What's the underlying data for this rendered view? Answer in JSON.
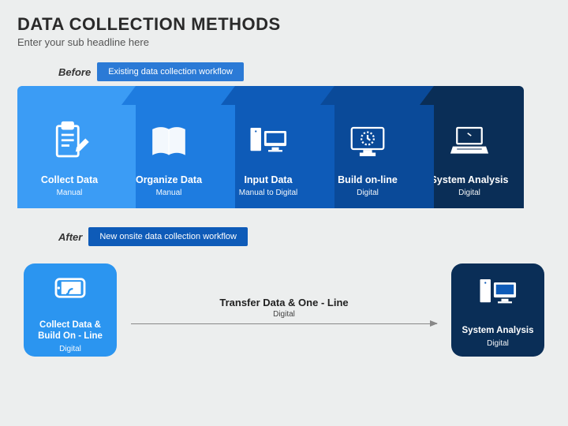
{
  "title": "DATA COLLECTION METHODS",
  "subtitle": "Enter your sub headline here",
  "before": {
    "label": "Before",
    "pill": "Existing data collection workflow",
    "pill_color": "#2b7ad6",
    "cards": [
      {
        "title": "Collect Data",
        "sub": "Manual",
        "color": "#3b9cf5",
        "icon": "clipboard"
      },
      {
        "title": "Organize Data",
        "sub": "Manual",
        "color": "#1e7ce0",
        "icon": "book"
      },
      {
        "title": "Input Data",
        "sub": "Manual to Digital",
        "color": "#0e5bb8",
        "icon": "desktop"
      },
      {
        "title": "Build on-line",
        "sub": "Digital",
        "color": "#0a4a99",
        "icon": "monitor"
      },
      {
        "title": "System Analysis",
        "sub": "Digital",
        "color": "#0a2e57",
        "icon": "laptop"
      }
    ]
  },
  "after": {
    "label": "After",
    "pill": "New onsite data collection workflow",
    "pill_color": "#0e5bb8",
    "left": {
      "title": "Collect Data & Build On - Line",
      "sub": "Digital",
      "color": "#2b95f0",
      "icon": "phone"
    },
    "arrow": {
      "title": "Transfer Data & One - Line",
      "sub": "Digital"
    },
    "right": {
      "title": "System Analysis",
      "sub": "Digital",
      "color": "#0a2e57",
      "icon": "desktop"
    }
  }
}
